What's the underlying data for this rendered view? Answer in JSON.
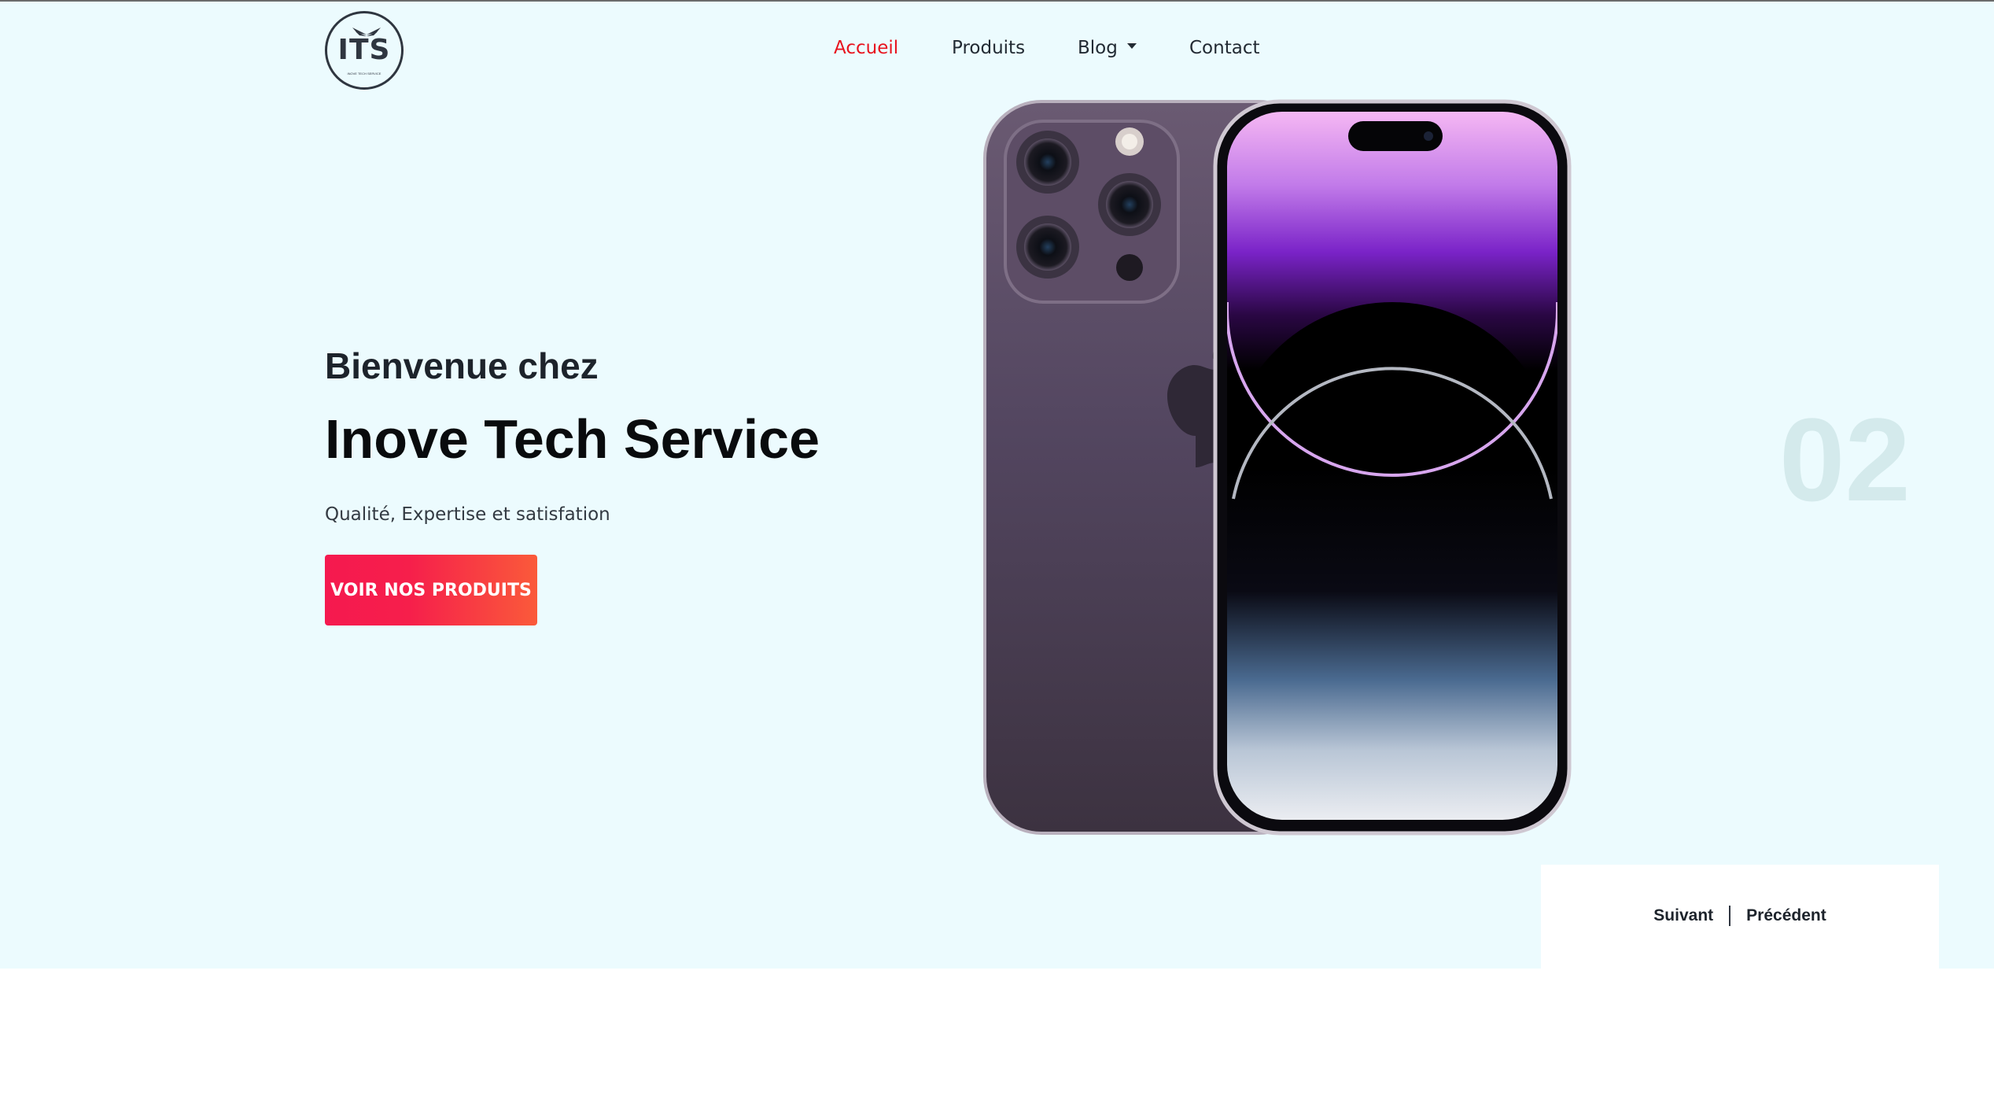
{
  "logo": {
    "text": "ITS",
    "subtext": "INOVE TECH SERVICE"
  },
  "nav": {
    "items": [
      {
        "label": "Accueil",
        "active": true
      },
      {
        "label": "Produits",
        "active": false
      },
      {
        "label": "Blog",
        "active": false,
        "has_dropdown": true
      },
      {
        "label": "Contact",
        "active": false
      }
    ]
  },
  "hero": {
    "welcome": "Bienvenue chez",
    "title": "Inove Tech Service",
    "tagline": "Qualité, Expertise et satisfation",
    "cta_label": "VOIR NOS PRODUITS",
    "slide_number": "02",
    "image_alt": "iPhone 14 Pro Deep Purple"
  },
  "slider": {
    "next_label": "Suivant",
    "prev_label": "Précédent"
  },
  "colors": {
    "hero_background": "#ecfbfe",
    "accent": "#e8131e",
    "cta_gradient_start": "#f5194f",
    "cta_gradient_end": "#fa5a3a",
    "slide_number": "#d4eaec"
  }
}
